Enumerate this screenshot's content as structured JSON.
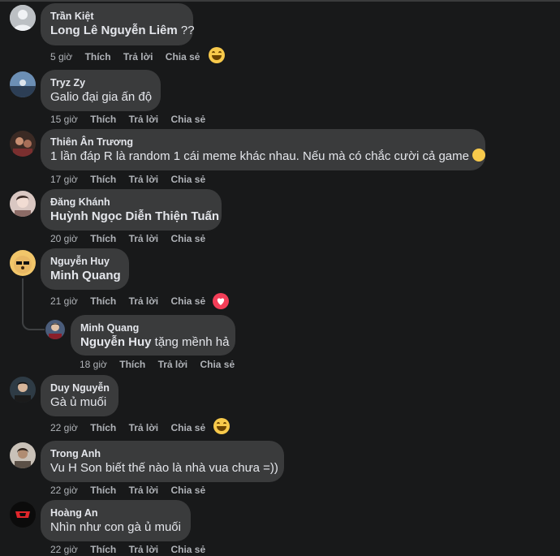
{
  "comments": [
    {
      "author": "Trần Kiệt",
      "mention": "Long Lê Nguyễn Liêm",
      "text": " ??",
      "time": "5 giờ",
      "reaction": "laugh"
    },
    {
      "author": "Tryz Zy",
      "mention": "",
      "text": "Galio đại gia ấn độ",
      "time": "15 giờ",
      "reaction": ""
    },
    {
      "author": "Thiên Ân Trương",
      "mention": "",
      "text": "1 lần đáp R là random 1 cái meme khác nhau. Nếu mà có chắc cười cả game",
      "time": "17 giờ",
      "reaction": "",
      "inline_emoji": "laugh"
    },
    {
      "author": "Đăng Khánh",
      "mention": "Huỳnh Ngọc Diễn Thiện Tuấn",
      "text": "",
      "time": "20 giờ",
      "reaction": ""
    },
    {
      "author": "Nguyễn Huy",
      "mention": "Minh Quang",
      "text": "",
      "time": "21 giờ",
      "reaction": "heart"
    },
    {
      "author": "Minh Quang",
      "mention": "Nguyễn Huy",
      "text": " tặng mềnh hả",
      "time": "18 giờ",
      "reaction": "",
      "reply": true
    },
    {
      "author": "Duy Nguyễn",
      "mention": "",
      "text": "Gà ủ muối",
      "time": "22 giờ",
      "reaction": "laugh"
    },
    {
      "author": "Trong Anh",
      "mention": "",
      "text": "Vu H Son biết thế nào là nhà vua chưa =))",
      "time": "22 giờ",
      "reaction": ""
    },
    {
      "author": "Hoàng An",
      "mention": "",
      "text": "Nhìn như con gà ủ muối",
      "time": "22 giờ",
      "reaction": ""
    }
  ],
  "actions": {
    "like": "Thích",
    "reply": "Trả lời",
    "share": "Chia sẻ"
  },
  "colors": {
    "background": "#18191a",
    "bubble": "#3a3b3c",
    "secondary_text": "#b0b3b8",
    "heart": "#f33e58",
    "laugh": "#f7c94b"
  }
}
